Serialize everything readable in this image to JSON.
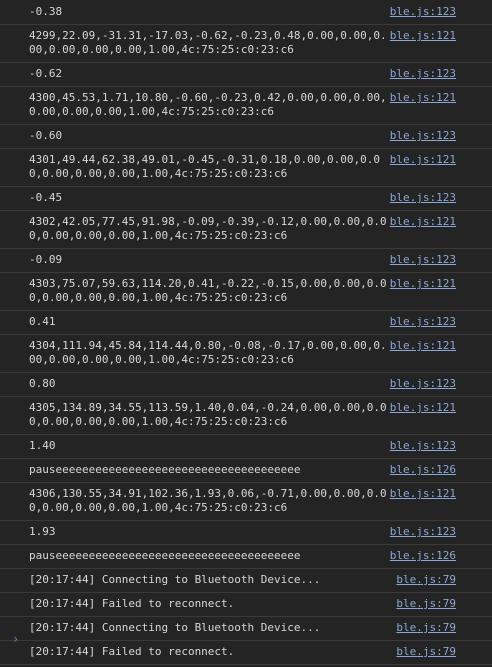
{
  "console": {
    "rows": [
      {
        "message": "-0.38",
        "source": "ble.js:123"
      },
      {
        "message": "4299,22.09,-31.31,-17.03,-0.62,-0.23,0.48,0.00,0.00,0.00,0.00,0.00,0.00,1.00,4c:75:25:c0:23:c6",
        "source": "ble.js:121"
      },
      {
        "message": "-0.62",
        "source": "ble.js:123"
      },
      {
        "message": "4300,45.53,1.71,10.80,-0.60,-0.23,0.42,0.00,0.00,0.00,0.00,0.00,0.00,1.00,4c:75:25:c0:23:c6",
        "source": "ble.js:121"
      },
      {
        "message": "-0.60",
        "source": "ble.js:123"
      },
      {
        "message": "4301,49.44,62.38,49.01,-0.45,-0.31,0.18,0.00,0.00,0.00,0.00,0.00,0.00,1.00,4c:75:25:c0:23:c6",
        "source": "ble.js:121"
      },
      {
        "message": "-0.45",
        "source": "ble.js:123"
      },
      {
        "message": "4302,42.05,77.45,91.98,-0.09,-0.39,-0.12,0.00,0.00,0.00,0.00,0.00,0.00,1.00,4c:75:25:c0:23:c6",
        "source": "ble.js:121"
      },
      {
        "message": "-0.09",
        "source": "ble.js:123"
      },
      {
        "message": "4303,75.07,59.63,114.20,0.41,-0.22,-0.15,0.00,0.00,0.00,0.00,0.00,0.00,1.00,4c:75:25:c0:23:c6",
        "source": "ble.js:121"
      },
      {
        "message": "0.41",
        "source": "ble.js:123"
      },
      {
        "message": "4304,111.94,45.84,114.44,0.80,-0.08,-0.17,0.00,0.00,0.00,0.00,0.00,0.00,1.00,4c:75:25:c0:23:c6",
        "source": "ble.js:121"
      },
      {
        "message": "0.80",
        "source": "ble.js:123"
      },
      {
        "message": "4305,134.89,34.55,113.59,1.40,0.04,-0.24,0.00,0.00,0.00,0.00,0.00,0.00,1.00,4c:75:25:c0:23:c6",
        "source": "ble.js:121"
      },
      {
        "message": "1.40",
        "source": "ble.js:123"
      },
      {
        "message": "pauseeeeeeeeeeeeeeeeeeeeeeeeeeeeeeeeeeeee",
        "source": "ble.js:126"
      },
      {
        "message": "4306,130.55,34.91,102.36,1.93,0.06,-0.71,0.00,0.00,0.00,0.00,0.00,0.00,1.00,4c:75:25:c0:23:c6",
        "source": "ble.js:121"
      },
      {
        "message": "1.93",
        "source": "ble.js:123"
      },
      {
        "message": "pauseeeeeeeeeeeeeeeeeeeeeeeeeeeeeeeeeeeee",
        "source": "ble.js:126"
      },
      {
        "message": "[20:17:44] Connecting to Bluetooth Device...",
        "source": "ble.js:79"
      },
      {
        "message": "[20:17:44] Failed to reconnect.",
        "source": "ble.js:79"
      },
      {
        "message": "[20:17:44] Connecting to Bluetooth Device...",
        "source": "ble.js:79"
      },
      {
        "message": "[20:17:44] Failed to reconnect.",
        "source": "ble.js:79"
      }
    ],
    "prompt_glyph": "›"
  },
  "colors": {
    "background": "#242424",
    "text": "#d7d7d7",
    "link": "#8aa7d6",
    "divider": "#3a3a3a",
    "prompt": "#4d8ad6"
  }
}
